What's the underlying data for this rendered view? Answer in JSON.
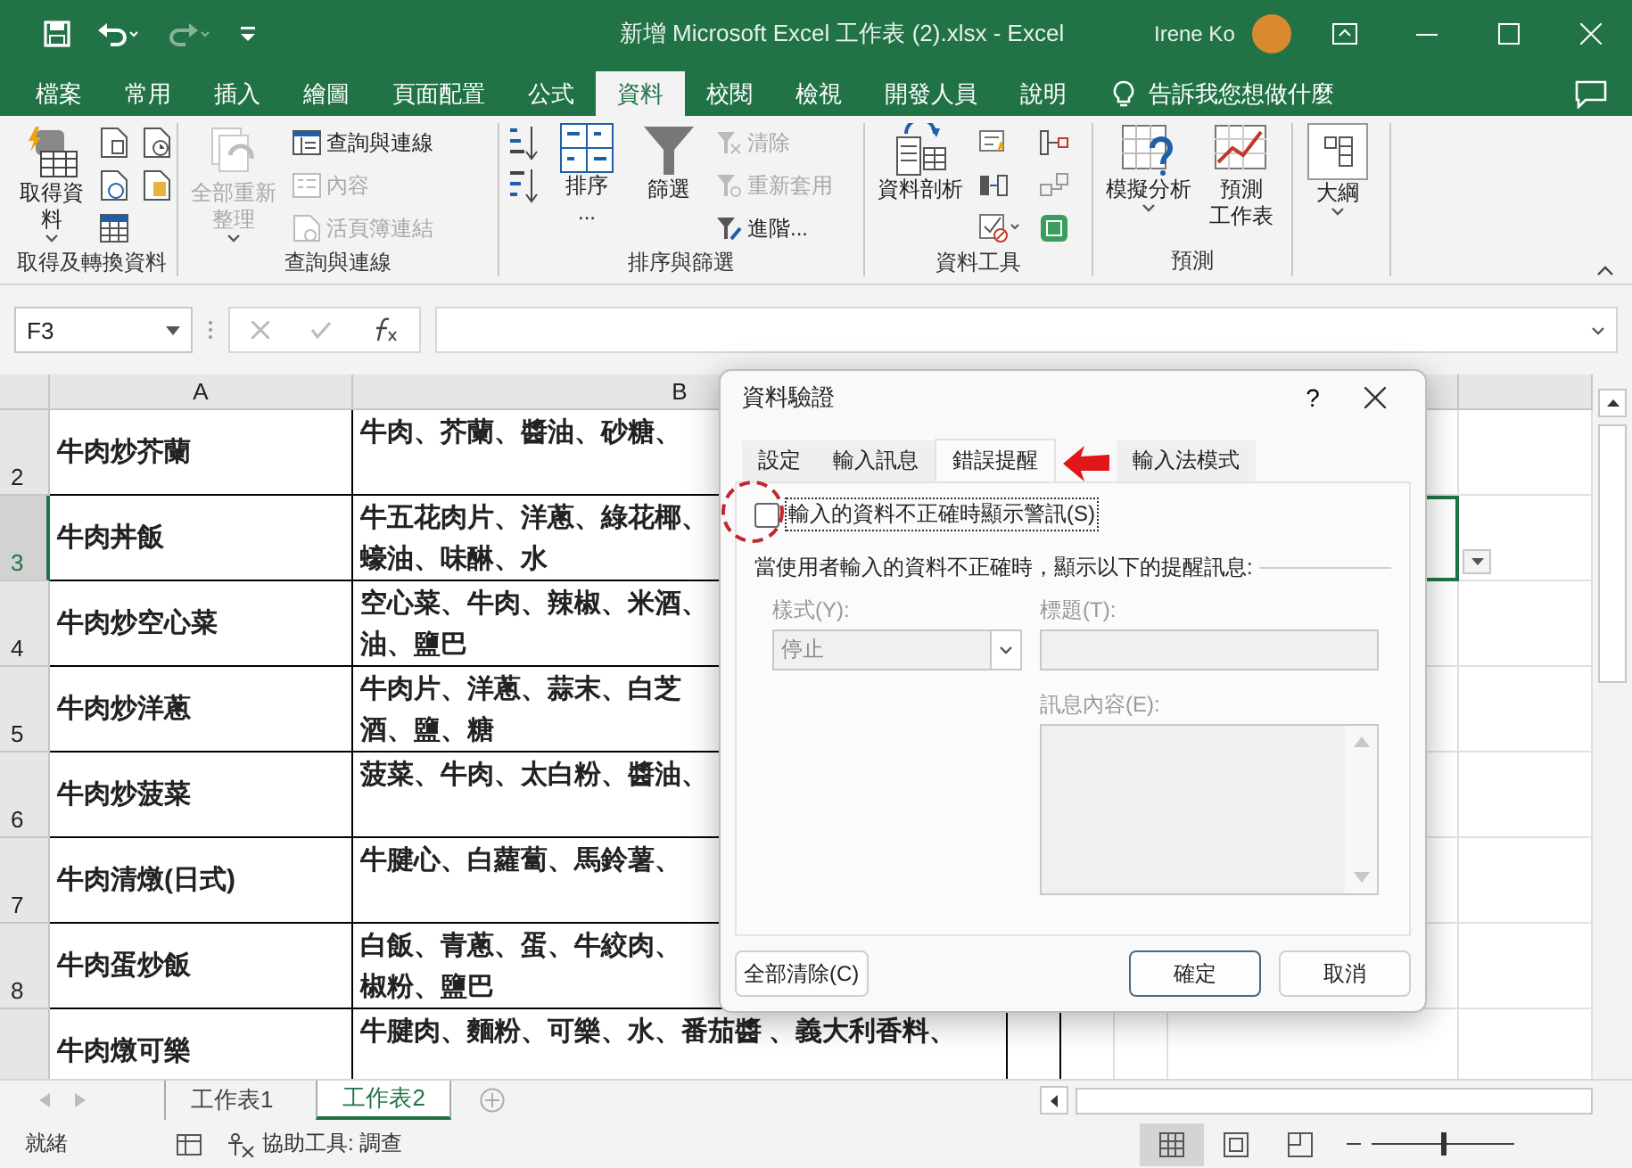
{
  "title_bar": {
    "title": "新增 Microsoft Excel 工作表 (2).xlsx  -  Excel",
    "user": "Irene Ko",
    "quick_access": [
      {
        "kind": "save",
        "disabled": false
      },
      {
        "kind": "undo",
        "disabled": false
      },
      {
        "kind": "redo",
        "disabled": true
      },
      {
        "kind": "customize",
        "disabled": false
      }
    ]
  },
  "menu_tabs": [
    {
      "label": "檔案",
      "selected": false
    },
    {
      "label": "常用",
      "selected": false
    },
    {
      "label": "插入",
      "selected": false
    },
    {
      "label": "繪圖",
      "selected": false
    },
    {
      "label": "頁面配置",
      "selected": false
    },
    {
      "label": "公式",
      "selected": false
    },
    {
      "label": "資料",
      "selected": true
    },
    {
      "label": "校閱",
      "selected": false
    },
    {
      "label": "檢視",
      "selected": false
    },
    {
      "label": "開發人員",
      "selected": false
    },
    {
      "label": "說明",
      "selected": false
    }
  ],
  "tell_me": "告訴我您想做什麼",
  "ribbon": {
    "groups": [
      {
        "label": "取得及轉換資料",
        "commands": [
          {
            "kind": "large",
            "lines": [
              "取得資料"
            ],
            "caret": true,
            "disabled": false
          },
          {
            "kind": "icon",
            "disabled": false
          },
          {
            "kind": "icon",
            "disabled": false
          },
          {
            "kind": "icon",
            "disabled": false
          },
          {
            "kind": "icon",
            "disabled": false
          },
          {
            "kind": "icon",
            "disabled": false
          }
        ]
      },
      {
        "label": "查詢與連線",
        "commands": [
          {
            "kind": "large",
            "lines": [
              "全部重新整理"
            ],
            "caret": true,
            "disabled": true
          },
          {
            "kind": "small",
            "label": "查詢與連線",
            "disabled": false
          },
          {
            "kind": "small",
            "label": "內容",
            "disabled": true
          },
          {
            "kind": "small",
            "label": "活頁簿連結",
            "disabled": true
          }
        ]
      },
      {
        "label": "排序與篩選",
        "commands": [
          {
            "kind": "icon",
            "disabled": false
          },
          {
            "kind": "icon",
            "disabled": false
          },
          {
            "kind": "large",
            "lines": [
              "排序",
              "..."
            ],
            "disabled": false
          },
          {
            "kind": "large",
            "lines": [
              "篩選"
            ],
            "disabled": false
          },
          {
            "kind": "small",
            "label": "清除",
            "disabled": true
          },
          {
            "kind": "small",
            "label": "重新套用",
            "disabled": true
          },
          {
            "kind": "small",
            "label": "進階...",
            "disabled": false
          }
        ]
      },
      {
        "label": "資料工具",
        "commands": [
          {
            "kind": "large",
            "lines": [
              "資料剖析"
            ],
            "disabled": false
          },
          {
            "kind": "icon",
            "disabled": false
          },
          {
            "kind": "icon",
            "disabled": false
          },
          {
            "kind": "icon",
            "disabled": false
          },
          {
            "kind": "icon",
            "disabled": false
          },
          {
            "kind": "icon",
            "disabled": false
          },
          {
            "kind": "icon",
            "disabled": false
          }
        ]
      },
      {
        "label": "預測",
        "commands": [
          {
            "kind": "large",
            "lines": [
              "模擬分析"
            ],
            "caret": true,
            "disabled": false
          },
          {
            "kind": "large",
            "lines": [
              "預測",
              "工作表"
            ],
            "disabled": false
          }
        ]
      },
      {
        "commands": [
          {
            "kind": "large",
            "lines": [
              "大綱"
            ],
            "caret": true,
            "disabled": false
          }
        ]
      }
    ]
  },
  "formula_bar": {
    "name_box": "F3"
  },
  "sheet": {
    "columns": [
      "A",
      "B"
    ],
    "rows": [
      {
        "number": "2",
        "selected": false,
        "cells": [
          "牛肉炒芥蘭",
          [
            "牛肉、芥蘭、醬油、砂糖、"
          ]
        ]
      },
      {
        "number": "3",
        "selected": true,
        "cells": [
          "牛肉丼飯",
          [
            "牛五花肉片、洋蔥、綠花椰、",
            "蠔油、味醂、水"
          ]
        ]
      },
      {
        "number": "4",
        "selected": false,
        "cells": [
          "牛肉炒空心菜",
          [
            "空心菜、牛肉、辣椒、米酒、",
            "油、鹽巴"
          ]
        ]
      },
      {
        "number": "5",
        "selected": false,
        "cells": [
          "牛肉炒洋蔥",
          [
            "牛肉片、洋蔥、蒜末、白芝",
            "酒、鹽、糖"
          ]
        ]
      },
      {
        "number": "6",
        "selected": false,
        "cells": [
          "牛肉炒菠菜",
          [
            "菠菜、牛肉、太白粉、醬油、"
          ]
        ]
      },
      {
        "number": "7",
        "selected": false,
        "cells": [
          "牛肉清燉(日式)",
          [
            "牛腱心、白蘿蔔、馬鈴薯、"
          ]
        ]
      },
      {
        "number": "8",
        "selected": false,
        "cells": [
          "牛肉蛋炒飯",
          [
            "白飯、青蔥、蛋、牛絞肉、",
            "椒粉、鹽巴"
          ]
        ]
      },
      {
        "selected": false,
        "cells": [
          "牛肉燉可樂",
          [
            "牛腱肉、麵粉、可樂、水、番茄醬 、義大利香料、"
          ]
        ]
      }
    ]
  },
  "dialog": {
    "title": "資料驗證",
    "help": "?",
    "tabs": [
      {
        "label": "設定",
        "selected": false
      },
      {
        "label": "輸入訊息",
        "selected": false
      },
      {
        "label": "錯誤提醒",
        "selected": true
      },
      {
        "label": "輸入法模式",
        "selected": false
      }
    ],
    "checkbox": {
      "label": "輸入的資料不正確時顯示警訊(S)",
      "checked": false
    },
    "section_label": "當使用者輸入的資料不正確時，顯示以下的提醒訊息:",
    "fields": [
      {
        "kind": "dropdown",
        "label": "樣式(Y):",
        "value": "停止",
        "disabled": true
      },
      {
        "kind": "input",
        "label": "標題(T):",
        "disabled": true
      },
      {
        "kind": "textarea",
        "label": "訊息內容(E):",
        "disabled": true
      }
    ],
    "buttons": [
      {
        "kind": "left",
        "label": "全部清除(C)"
      },
      {
        "kind": "default",
        "label": "確定"
      },
      {
        "kind": "normal",
        "label": "取消"
      }
    ]
  },
  "annotations": [
    {
      "kind": "arrow"
    },
    {
      "kind": "circle"
    }
  ],
  "sheet_tabs": [
    {
      "label": "工作表1",
      "selected": false
    },
    {
      "label": "工作表2",
      "selected": true
    }
  ],
  "status_bar": {
    "mode": "就緒",
    "accessibility": "協助工具: 調查",
    "views": [
      {
        "kind": "normal",
        "selected": true
      },
      {
        "kind": "page_layout",
        "selected": false
      },
      {
        "kind": "page_break",
        "selected": false
      }
    ],
    "zoom": {
      "level": 0.5
    }
  }
}
